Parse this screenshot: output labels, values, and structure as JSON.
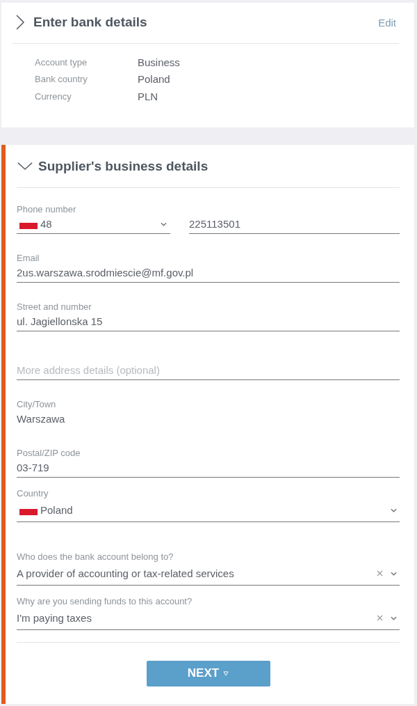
{
  "bank_section": {
    "title": "Enter bank details",
    "expanded": false,
    "active": false,
    "edit_link": "Edit",
    "details": [
      {
        "label": "Account type",
        "value": "Business"
      },
      {
        "label": "Bank country",
        "value": "Poland"
      },
      {
        "label": "Currency",
        "value": "PLN"
      }
    ]
  },
  "supplier_section": {
    "title": "Supplier's business details",
    "expanded": true,
    "active": true,
    "phone": {
      "label": "Phone number",
      "country_code": "48",
      "number": "225113501"
    },
    "fields": [
      {
        "kind": "text",
        "label": "Email",
        "value": "2us.warszawa.srodmiescie@mf.gov.pl"
      },
      {
        "kind": "text",
        "label": "Street and number",
        "value": "ul. Jagiellonska 15"
      },
      {
        "kind": "text",
        "placeholder": "More address details (optional)"
      },
      {
        "kind": "plain",
        "label": "City/Town",
        "value": "Warszawa"
      },
      {
        "kind": "text",
        "label": "Postal/ZIP code",
        "value": "03-719"
      },
      {
        "kind": "country",
        "label": "Country",
        "value": "Poland"
      }
    ],
    "questions": [
      {
        "label": "Who does the bank account belong to?",
        "value": "A provider of accounting or tax-related services"
      },
      {
        "label": "Why are you sending funds to this account?",
        "value": "I'm paying taxes"
      }
    ],
    "next_button": "NEXT"
  }
}
